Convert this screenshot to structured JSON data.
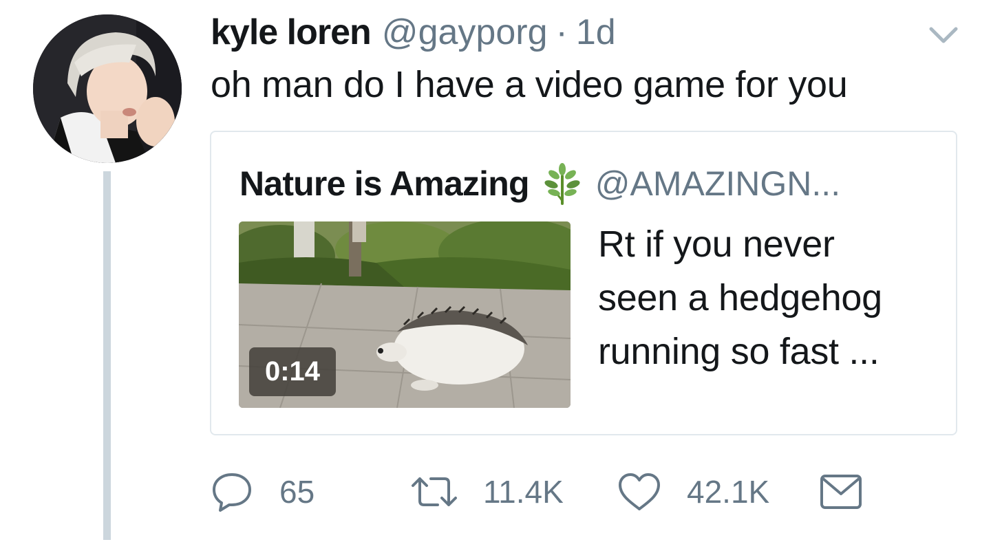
{
  "tweet": {
    "display_name": "kyle loren",
    "handle": "@gayporg",
    "separator": "·",
    "time": "1d",
    "text": "oh man do I have a video game for you",
    "avatar_icon": "profile-photo"
  },
  "quote": {
    "display_name": "Nature is Amazing",
    "emoji_icon": "herb-emoji",
    "handle": "@AMAZINGN...",
    "video_duration": "0:14",
    "text_lines": [
      "Rt if you never",
      "seen a hedgehog",
      "running so fast ..."
    ]
  },
  "actions": {
    "reply_count": "65",
    "retweet_count": "11.4K",
    "like_count": "42.1K"
  },
  "colors": {
    "text": "#14171a",
    "muted": "#657786",
    "border": "#e1e8ed",
    "thread_line": "#ccd6dd"
  }
}
